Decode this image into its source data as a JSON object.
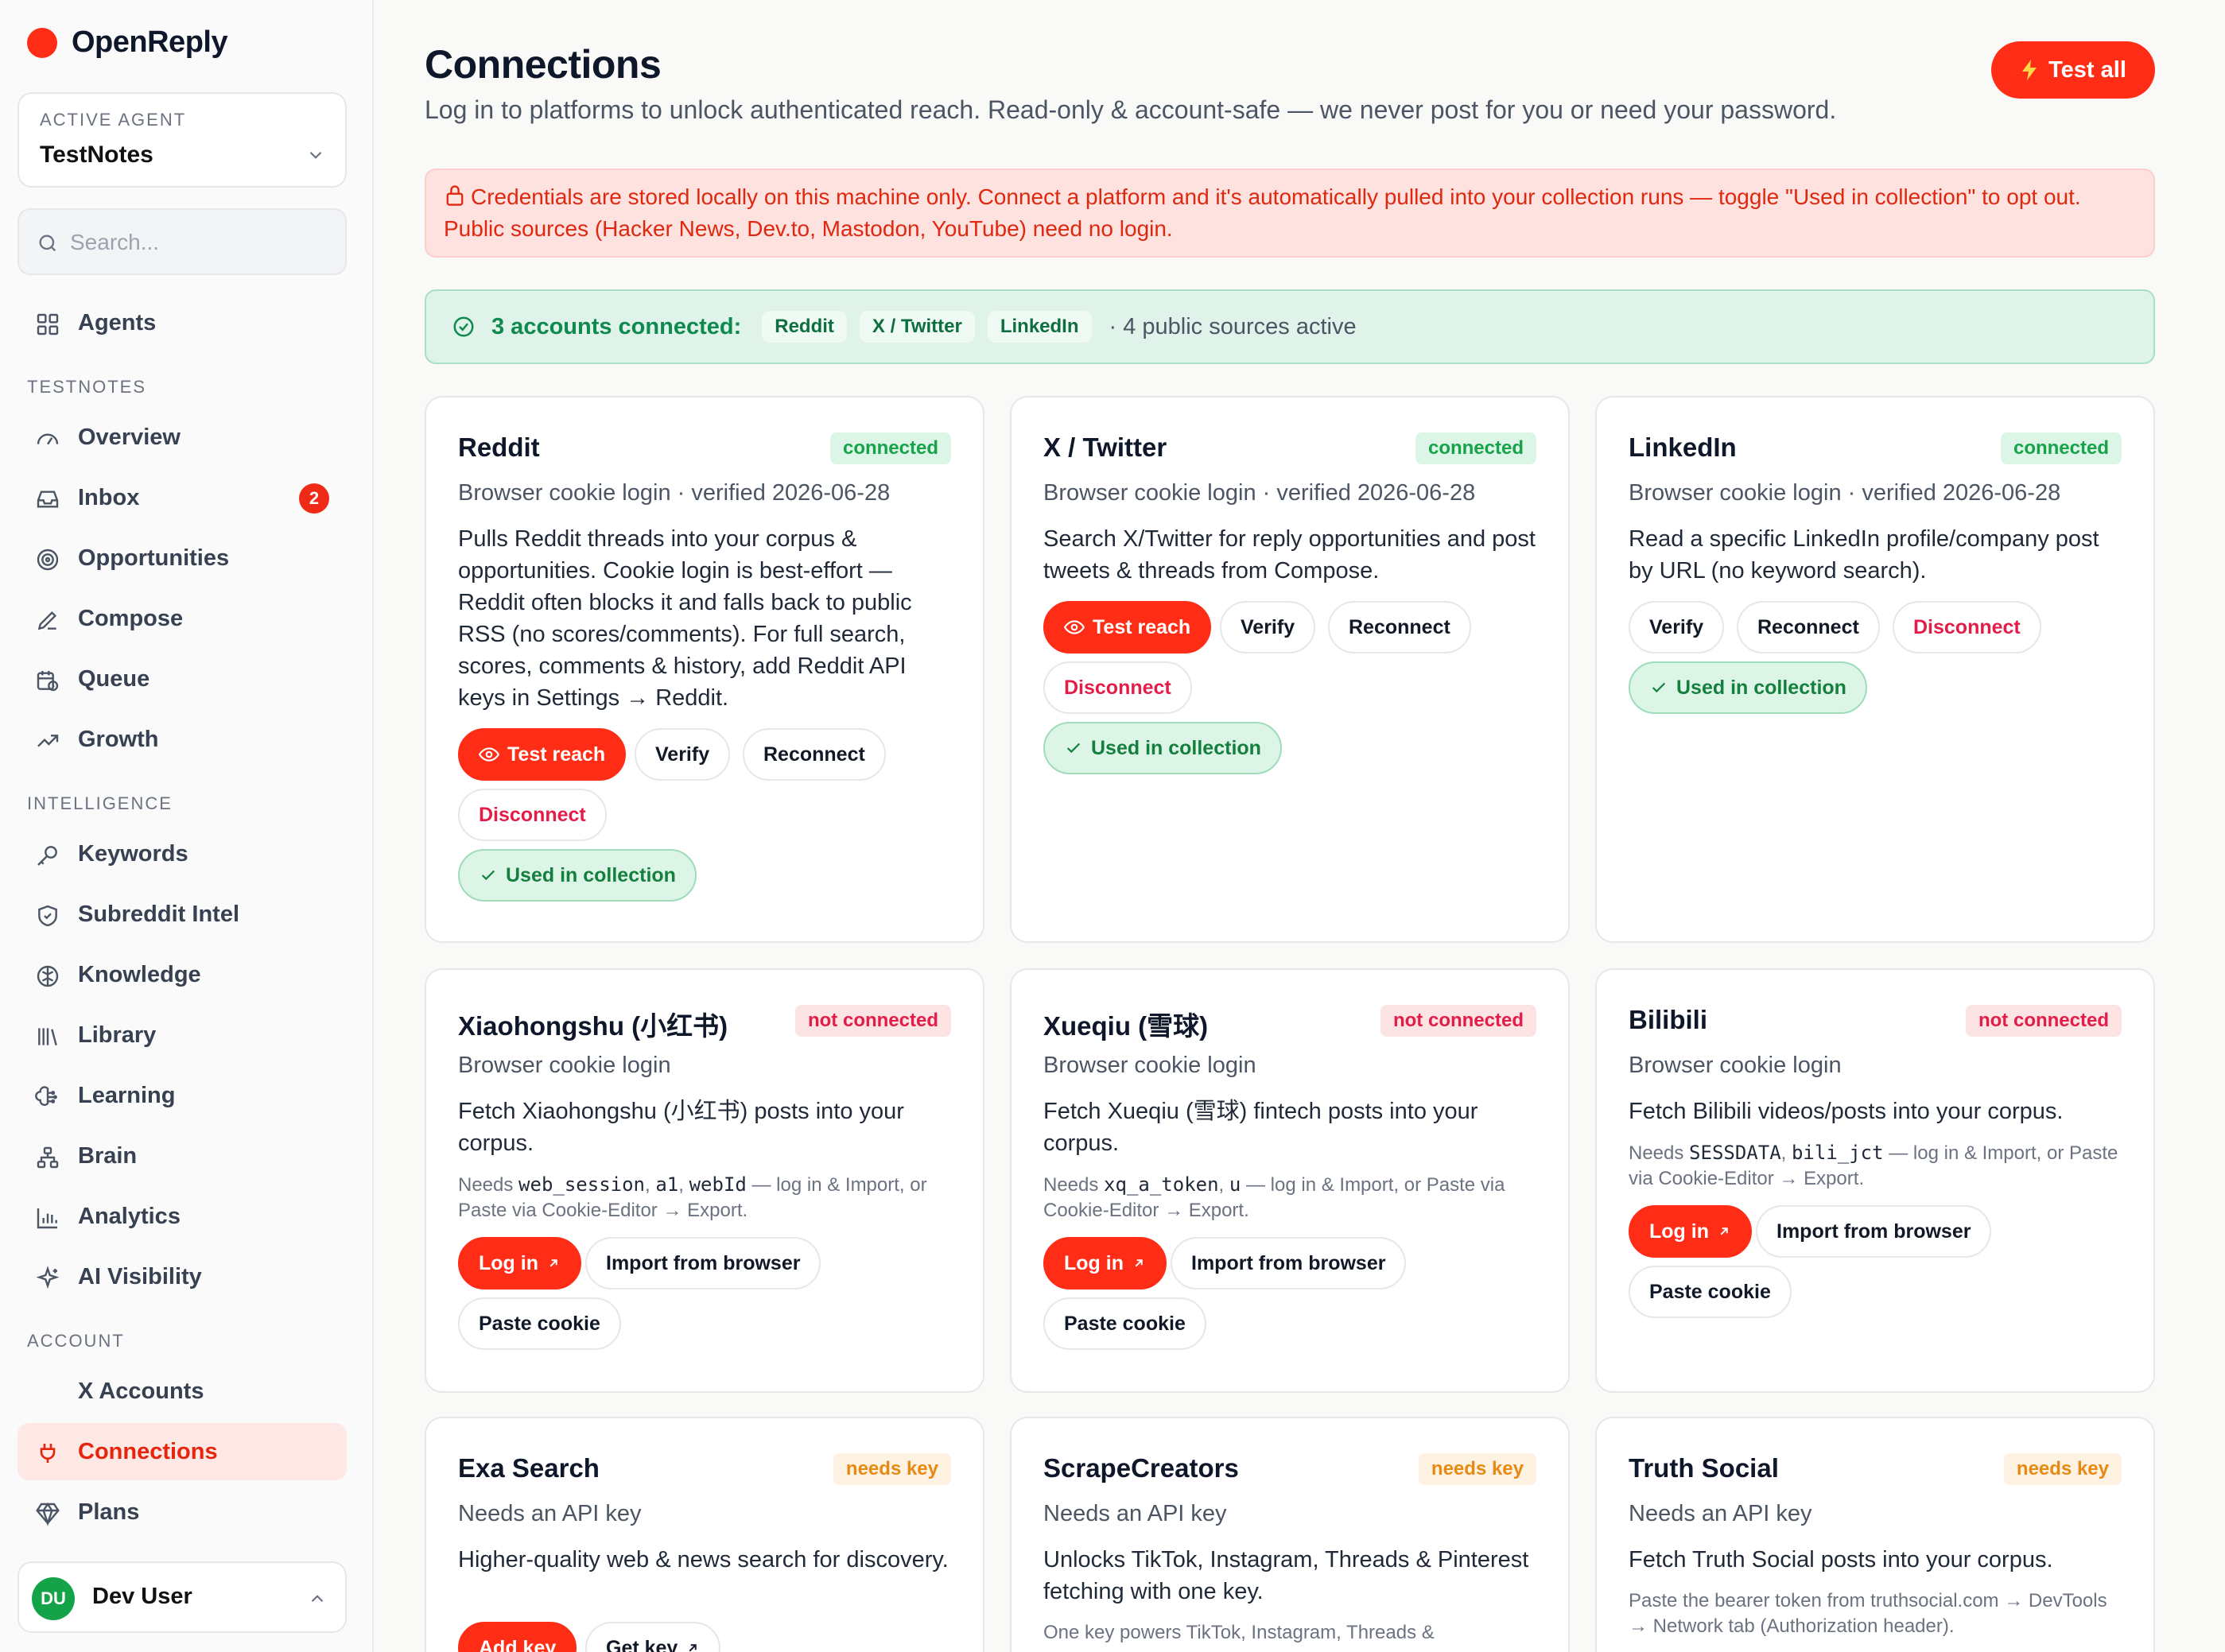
{
  "brand": {
    "name": "OpenReply",
    "color": "#ff2d16"
  },
  "agent": {
    "label": "ACTIVE AGENT",
    "name": "TestNotes"
  },
  "search": {
    "placeholder": "Search..."
  },
  "nav": {
    "agents": "Agents",
    "section_testnotes": "TESTNOTES",
    "overview": "Overview",
    "inbox": "Inbox",
    "inbox_badge": "2",
    "opportunities": "Opportunities",
    "compose": "Compose",
    "queue": "Queue",
    "growth": "Growth",
    "section_intelligence": "INTELLIGENCE",
    "keywords": "Keywords",
    "subreddit_intel": "Subreddit Intel",
    "knowledge": "Knowledge",
    "library": "Library",
    "learning": "Learning",
    "brain": "Brain",
    "analytics": "Analytics",
    "ai_visibility": "AI Visibility",
    "section_account": "ACCOUNT",
    "x_accounts": "X Accounts",
    "connections": "Connections",
    "plans": "Plans"
  },
  "user": {
    "initials": "DU",
    "name": "Dev User"
  },
  "header": {
    "title": "Connections",
    "subtitle": "Log in to platforms to unlock authenticated reach. Read-only & account-safe — we never post for you or need your password.",
    "test_all": "Test all"
  },
  "alert": {
    "text": "Credentials are stored locally on this machine only. Connect a platform and it's automatically pulled into your collection runs — toggle \"Used in collection\" to opt out. Public sources (Hacker News, Dev.to, Mastodon, YouTube) need no login."
  },
  "connected_bar": {
    "title": "3 accounts connected:",
    "chips": [
      "Reddit",
      "X / Twitter",
      "LinkedIn"
    ],
    "public": "· 4 public sources active"
  },
  "buttons": {
    "test_reach": "Test reach",
    "verify": "Verify",
    "reconnect": "Reconnect",
    "disconnect": "Disconnect",
    "used_in_collection": "Used in collection",
    "log_in": "Log in",
    "import_from_browser": "Import from browser",
    "paste_cookie": "Paste cookie",
    "add_key": "Add key",
    "get_key": "Get key"
  },
  "cards": {
    "reddit": {
      "title": "Reddit",
      "status": "connected",
      "meta": "Browser cookie login · verified 2026-06-28",
      "desc": "Pulls Reddit threads into your corpus & opportunities. Cookie login is best-effort — Reddit often blocks it and falls back to public RSS (no scores/comments). For full search, scores, comments & history, add Reddit API keys in Settings → Reddit."
    },
    "twitter": {
      "title": "X / Twitter",
      "status": "connected",
      "meta": "Browser cookie login · verified 2026-06-28",
      "desc": "Search X/Twitter for reply opportunities and post tweets & threads from Compose."
    },
    "linkedin": {
      "title": "LinkedIn",
      "status": "connected",
      "meta": "Browser cookie login · verified 2026-06-28",
      "desc": "Read a specific LinkedIn profile/company post by URL (no keyword search)."
    },
    "xiaohongshu": {
      "title": "Xiaohongshu (小红书)",
      "status": "not connected",
      "meta": "Browser cookie login",
      "desc": "Fetch Xiaohongshu (小红书) posts into your corpus.",
      "note_prefix": "Needs ",
      "note_code1": "web_session",
      "note_sep1": ", ",
      "note_code2": "a1",
      "note_sep2": ", ",
      "note_code3": "webId",
      "note_suffix": " — log in & Import, or Paste via Cookie-Editor → Export."
    },
    "xueqiu": {
      "title": "Xueqiu (雪球)",
      "status": "not connected",
      "meta": "Browser cookie login",
      "desc": "Fetch Xueqiu (雪球) fintech posts into your corpus.",
      "note_prefix": "Needs ",
      "note_code1": "xq_a_token",
      "note_sep1": ", ",
      "note_code2": "u",
      "note_suffix": " — log in & Import, or Paste via Cookie-Editor → Export."
    },
    "bilibili": {
      "title": "Bilibili",
      "status": "not connected",
      "meta": "Browser cookie login",
      "desc": "Fetch Bilibili videos/posts into your corpus.",
      "note_prefix": "Needs ",
      "note_code1": "SESSDATA",
      "note_sep1": ", ",
      "note_code2": "bili_jct",
      "note_suffix": " — log in & Import, or Paste via Cookie-Editor → Export."
    },
    "exa": {
      "title": "Exa Search",
      "status": "needs key",
      "meta": "Needs an API key",
      "desc": "Higher-quality web & news search for discovery."
    },
    "scrapecreators": {
      "title": "ScrapeCreators",
      "status": "needs key",
      "meta": "Needs an API key",
      "desc": "Unlocks TikTok, Instagram, Threads & Pinterest fetching with one key.",
      "note": "One key powers TikTok, Instagram, Threads &"
    },
    "truthsocial": {
      "title": "Truth Social",
      "status": "needs key",
      "meta": "Needs an API key",
      "desc": "Fetch Truth Social posts into your corpus.",
      "note": "Paste the bearer token from truthsocial.com → DevTools → Network tab (Authorization header)."
    }
  },
  "colors": {
    "accent": "#ff2d16",
    "connected": "#16a34a",
    "not_connected": "#e11d48",
    "needs_key": "#e88a12"
  }
}
